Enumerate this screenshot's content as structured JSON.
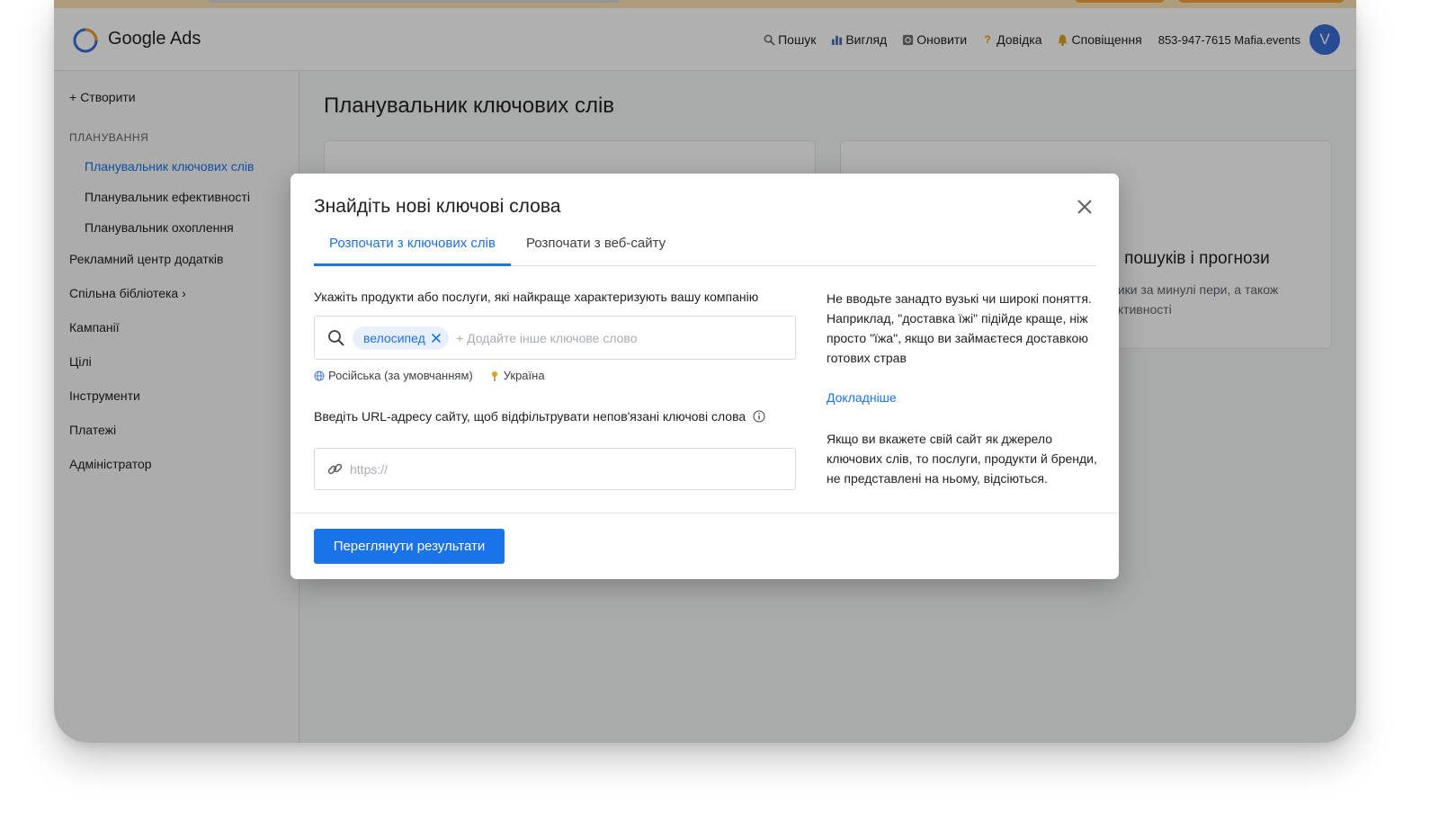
{
  "app": {
    "title": "Google Ads"
  },
  "header": {
    "actions": [
      {
        "label": "Пошук",
        "icon": "search-icon"
      },
      {
        "label": "Вигляд",
        "icon": "bar-chart-icon"
      },
      {
        "label": "Оновити",
        "icon": "refresh-icon"
      },
      {
        "label": "Довідка",
        "icon": "help-icon"
      },
      {
        "label": "Сповіщення",
        "icon": "bell-icon"
      }
    ],
    "account": "853-947-7615 Mafia.events",
    "avatar_letter": "V"
  },
  "sidebar": {
    "create": "Створити",
    "section": "ПЛАНУВАННЯ",
    "sub_items": [
      {
        "label": "Планувальник ключових слів",
        "active": true
      },
      {
        "label": "Планувальник ефективності"
      },
      {
        "label": "Планувальник охоплення"
      }
    ],
    "items": [
      {
        "label": "Рекламний центр додатків"
      },
      {
        "label": "Спільна бібліотека ›"
      },
      {
        "label": "Кампанії"
      },
      {
        "label": "Цілі"
      },
      {
        "label": "Інструменти"
      },
      {
        "label": "Платежі"
      },
      {
        "label": "Адміністратор"
      }
    ]
  },
  "main": {
    "title": "Планувальник ключових слів",
    "card_right": {
      "heading": "ь пошуків і прогнози",
      "text": "ники за минулі пери, а також ективності"
    }
  },
  "modal": {
    "title": "Знайдіть нові ключові слова",
    "tabs": [
      {
        "label": "Розпочати з ключових слів",
        "active": true
      },
      {
        "label": "Розпочати з веб-сайту"
      }
    ],
    "products_label": "Укажіть продукти або послуги, які найкраще характеризують вашу компанію",
    "keyword_chip": "велосипед",
    "keyword_placeholder": "+ Додайте інше ключове слово",
    "language": "Російська (за умовчанням)",
    "location": "Україна",
    "url_label": "Введіть URL-адресу сайту, щоб відфільтрувати непов'язані ключові слова",
    "url_placeholder": "https://",
    "help_text_1": "Не вводьте занадто вузькі чи широкі поняття. Наприклад, \"доставка їжі\" підійде краще, ніж просто \"їжа\", якщо ви займаєтеся доставкою готових страв",
    "help_link": "Докладніше",
    "help_text_2": "Якщо ви вкажете свій сайт як джерело ключових слів, то послуги, продукти й бренди, не представлені на ньому, відсіються.",
    "submit": "Переглянути результати"
  },
  "colors": {
    "accent": "#1a73e8",
    "avatar": "#3b6ed6",
    "promo": "#fce2b5"
  }
}
